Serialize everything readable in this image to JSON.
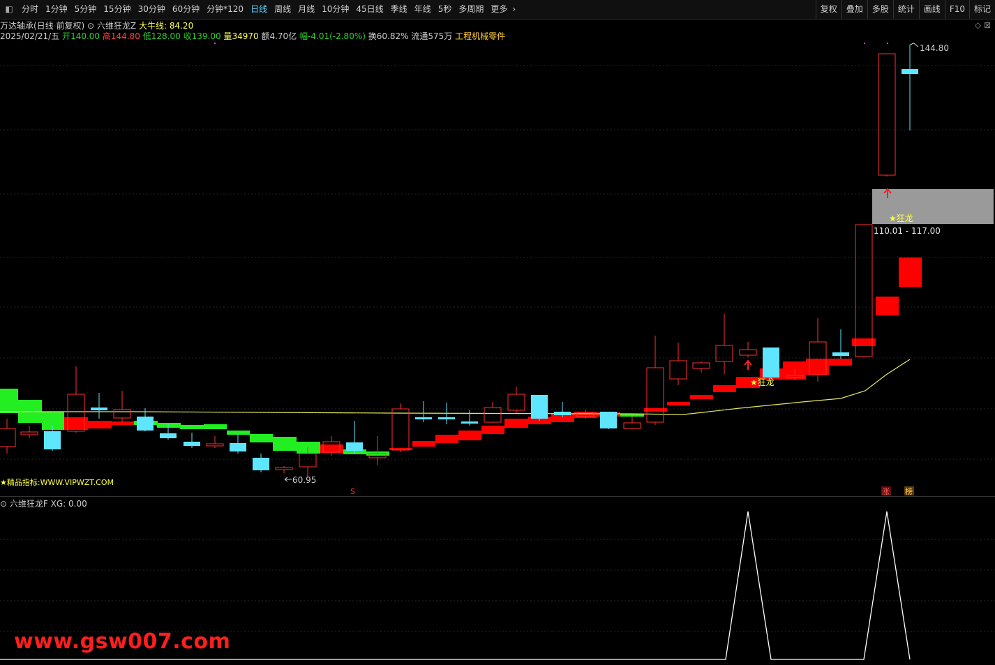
{
  "toolbar": {
    "left_icon": "square-icon",
    "periods": [
      "分时",
      "1分钟",
      "5分钟",
      "15分钟",
      "30分钟",
      "60分钟",
      "分钟*120",
      "日线",
      "周线",
      "月线",
      "10分钟",
      "45日线",
      "季线",
      "年线",
      "5秒",
      "多周期",
      "更多"
    ],
    "active_period": "日线",
    "right_items": [
      "复权",
      "叠加",
      "多股",
      "统计",
      "画线",
      "F10",
      "标记"
    ]
  },
  "info": {
    "stock_name": "万达轴承(日线 前复权)",
    "indicator_name": "六维狂龙Z",
    "bull_line_label": "大牛线:",
    "bull_line_value": "84.20",
    "date": "2025/02/21/五",
    "open_label": "开",
    "open": "140.00",
    "high_label": "高",
    "high": "144.80",
    "low_label": "低",
    "low": "128.00",
    "close_label": "收",
    "close": "139.00",
    "volume_label": "量",
    "volume": "34970",
    "amount_label": "额",
    "amount": "4.70亿",
    "change_label": "幅",
    "change": "-4.01(-2.80%)",
    "turnover_label": "换",
    "turnover": "60.82%",
    "float_label": "流通",
    "float": "575万",
    "industry": "工程机械零件"
  },
  "chart": {
    "high_marker": "144.80",
    "low_marker": "60.95",
    "range_label": "110.01 - 117.00",
    "signal_label_1": "★狂龙",
    "signal_label_2": "★狂龙",
    "promo_text": "★精品指标:WWW.VIPWZT.COM",
    "badge_s": "S",
    "badge_zhang": "涨",
    "badge_bang": "榜"
  },
  "sub_indicator": {
    "name": "六维狂龙F",
    "value_label": "XG:",
    "value": "0.00"
  },
  "watermark": "www.gsw007.com",
  "colors": {
    "up": "#ff3030",
    "down": "#5fe6ff",
    "ribbon_green": "#22ee22",
    "ribbon_red": "#ff0000",
    "ma_line": "#e6e65a",
    "zone": "#9a9a9a"
  }
}
